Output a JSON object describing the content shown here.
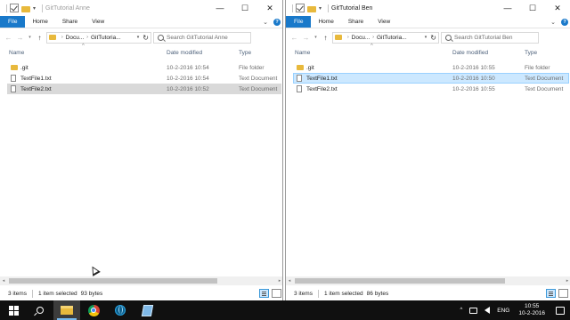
{
  "colors": {
    "file_tab": "#1979ca",
    "selection": "#cce8ff",
    "taskbar": "#101010",
    "folder": "#e8b93c"
  },
  "left": {
    "title": "GitTutorial Anne",
    "tabs": {
      "file": "File",
      "home": "Home",
      "share": "Share",
      "view": "View"
    },
    "address": {
      "crumb1": "Docu...",
      "crumb2": "GitTutoria..."
    },
    "search_placeholder": "Search GitTutorial Anne",
    "columns": {
      "name": "Name",
      "date": "Date modified",
      "type": "Type"
    },
    "files": [
      {
        "name": ".git",
        "date": "10-2-2016 10:54",
        "type": "File folder",
        "icon": "folder-icon"
      },
      {
        "name": "TextFile1.txt",
        "date": "10-2-2016 10:54",
        "type": "Text Document",
        "icon": "text-file-icon"
      },
      {
        "name": "TextFile2.txt",
        "date": "10-2-2016 10:52",
        "type": "Text Document",
        "icon": "text-file-icon",
        "selected": true
      }
    ],
    "status": {
      "items": "3 items",
      "selected": "1 item selected",
      "size": "93 bytes"
    }
  },
  "right": {
    "title": "GitTutorial Ben",
    "tabs": {
      "file": "File",
      "home": "Home",
      "share": "Share",
      "view": "View"
    },
    "address": {
      "crumb1": "Docu...",
      "crumb2": "GitTutoria..."
    },
    "search_placeholder": "Search GitTutorial Ben",
    "columns": {
      "name": "Name",
      "date": "Date modified",
      "type": "Type"
    },
    "files": [
      {
        "name": ".git",
        "date": "10-2-2016 10:55",
        "type": "File folder",
        "icon": "folder-icon"
      },
      {
        "name": "TextFile1.txt",
        "date": "10-2-2016 10:50",
        "type": "Text Document",
        "icon": "text-file-icon",
        "selected": true
      },
      {
        "name": "TextFile2.txt",
        "date": "10-2-2016 10:55",
        "type": "Text Document",
        "icon": "text-file-icon"
      }
    ],
    "status": {
      "items": "3 items",
      "selected": "1 item selected",
      "size": "86 bytes"
    }
  },
  "taskbar": {
    "apps": [
      "start-icon",
      "search-icon",
      "file-explorer-icon",
      "chrome-icon",
      "network-globe-icon",
      "notepad-icon"
    ],
    "tray": {
      "language": "ENG",
      "time": "10:55",
      "date": "10-2-2016"
    }
  }
}
